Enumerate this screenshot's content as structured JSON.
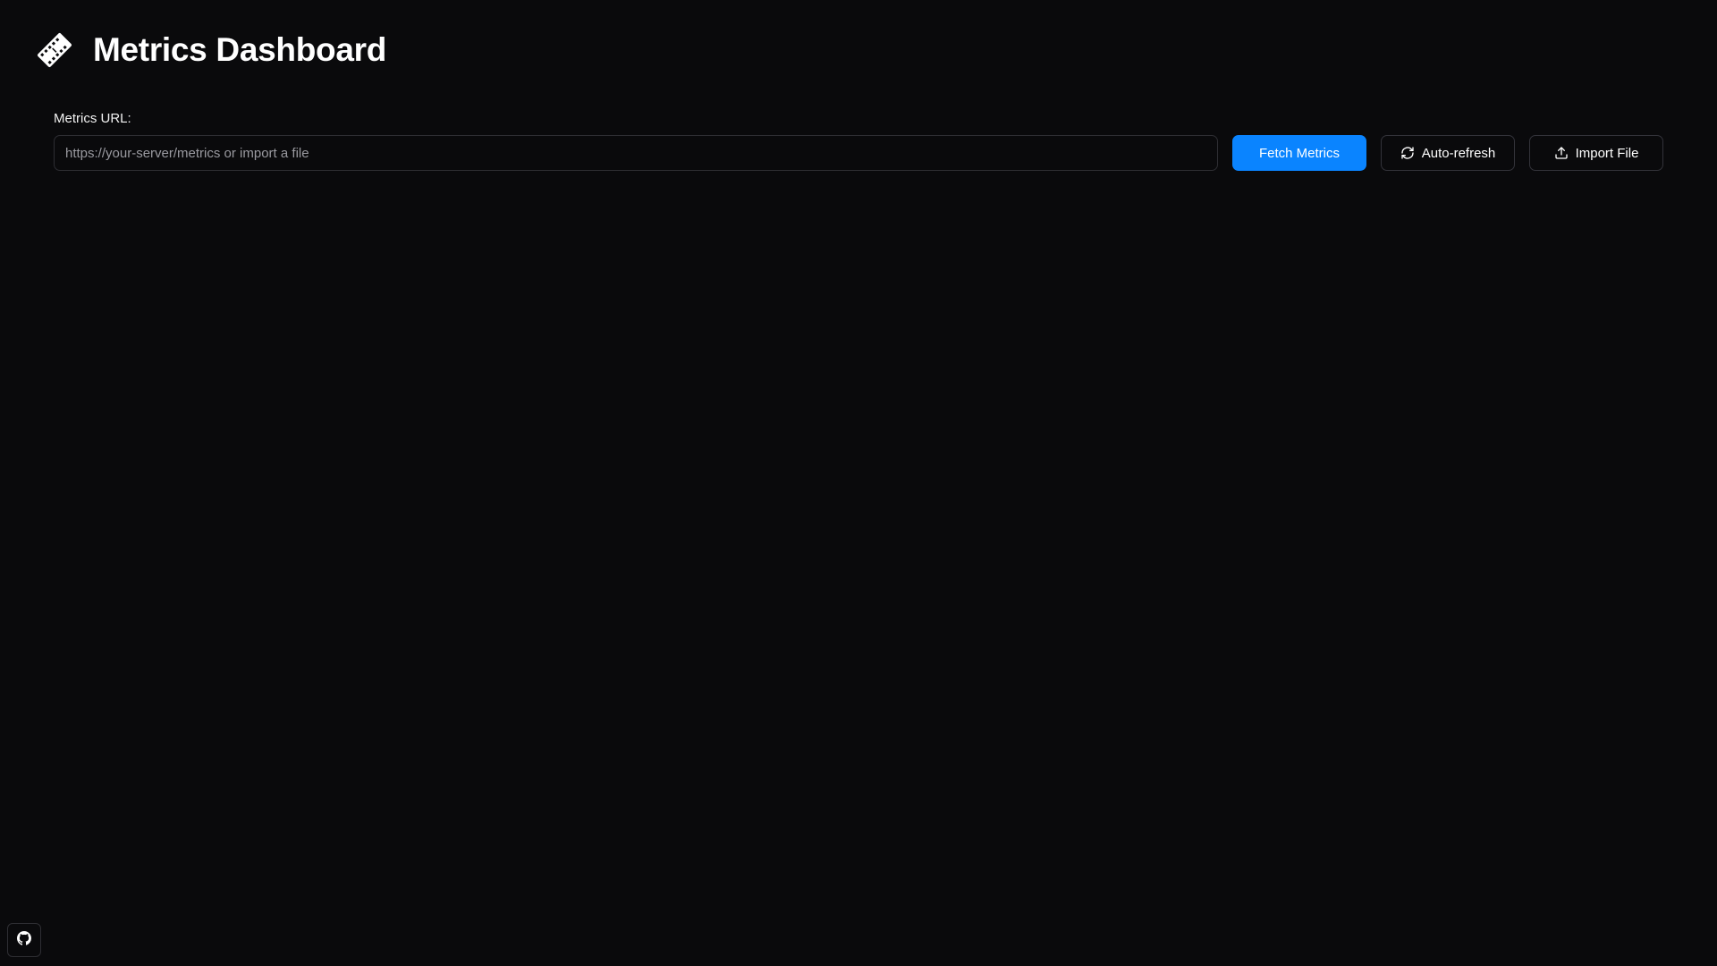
{
  "header": {
    "title": "Metrics Dashboard",
    "logo_icon": "film-icon"
  },
  "controls": {
    "url_label": "Metrics URL:",
    "url_value": "",
    "url_placeholder": "https://your-server/metrics or import a file",
    "fetch_label": "Fetch Metrics",
    "auto_refresh_label": "Auto-refresh",
    "auto_refresh_icon": "refresh-icon",
    "import_label": "Import File",
    "import_icon": "upload-icon"
  },
  "footer": {
    "github_icon": "github-icon"
  },
  "colors": {
    "background": "#0a0a0c",
    "accent": "#0a84ff",
    "border": "#2e2e33",
    "text": "#ffffff",
    "placeholder": "#9a9aa0"
  }
}
